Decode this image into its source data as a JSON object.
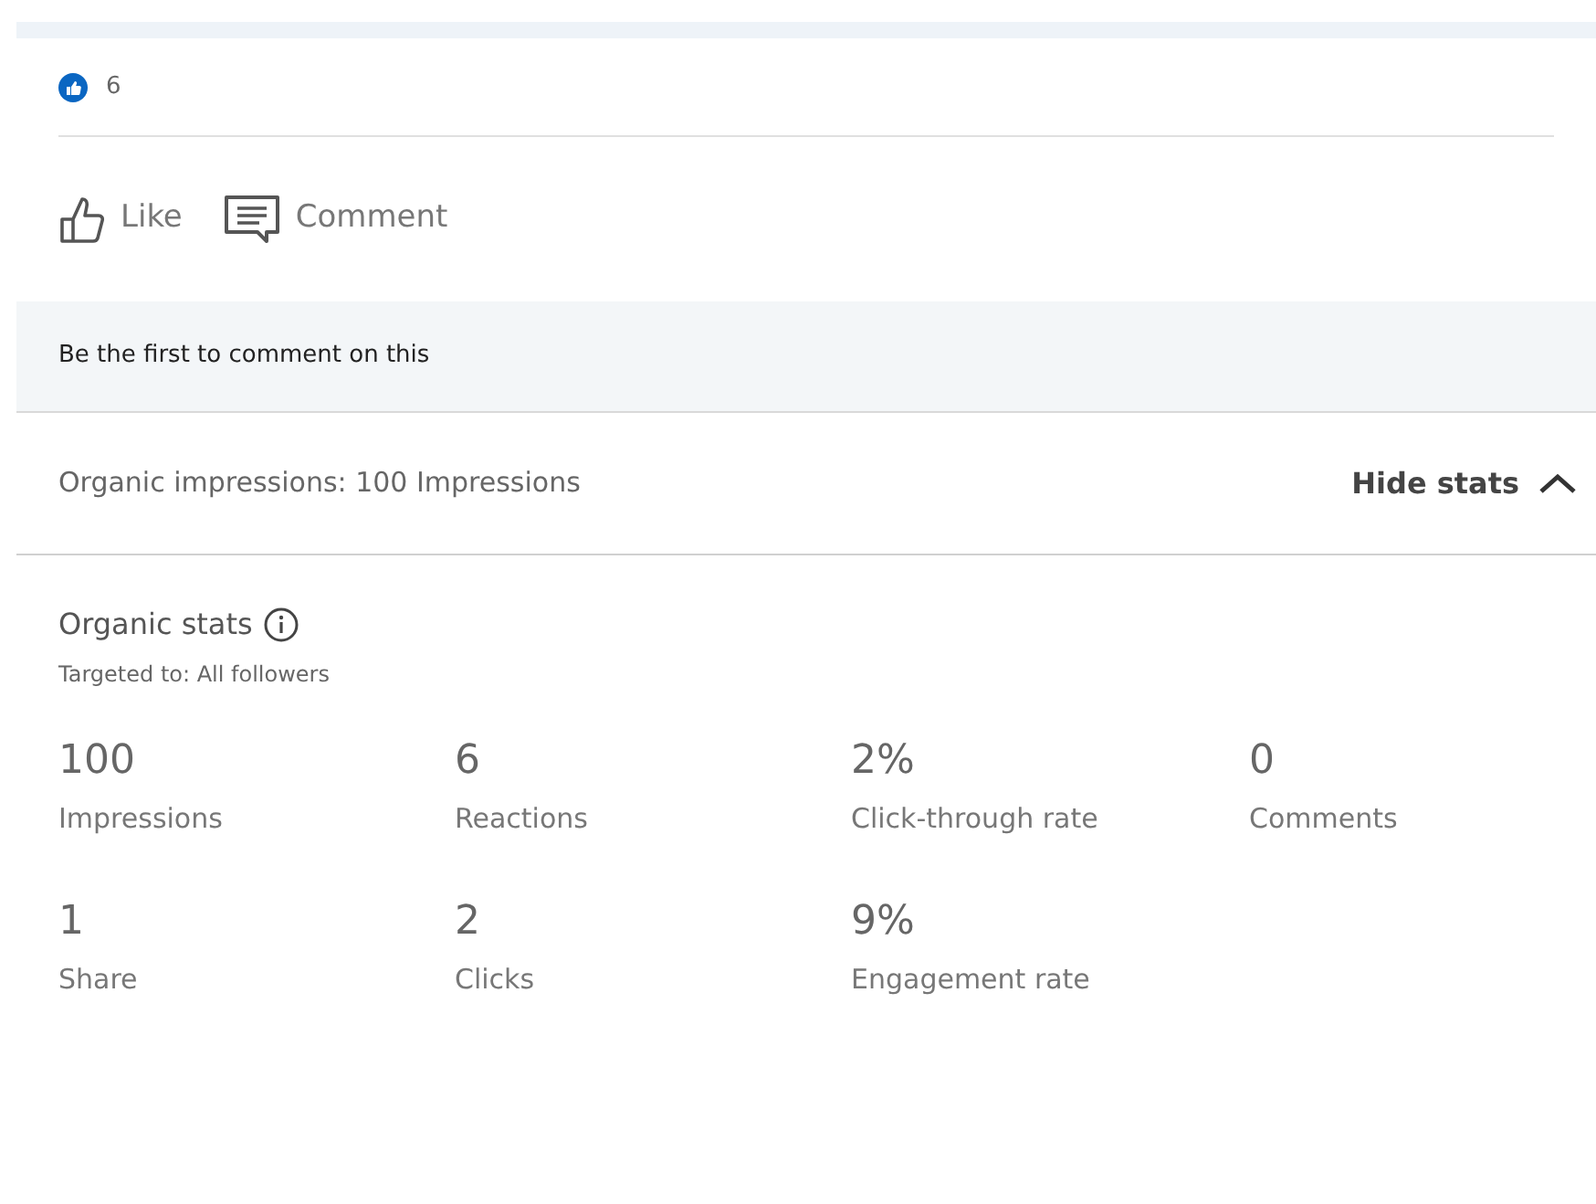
{
  "reactions": {
    "count": "6"
  },
  "actions": [
    {
      "kind": "like",
      "label": "Like"
    },
    {
      "kind": "comment",
      "label": "Comment"
    }
  ],
  "comments_banner": "Be the first to comment on this",
  "impressions_bar": {
    "summary": "Organic impressions: 100 Impressions",
    "toggle": "Hide stats",
    "expanded": true
  },
  "stats": {
    "title": "Organic stats",
    "targeting": "Targeted to: All followers",
    "items": [
      {
        "value": "100",
        "label": "Impressions"
      },
      {
        "value": "6",
        "label": "Reactions"
      },
      {
        "value": "2%",
        "label": "Click-through rate"
      },
      {
        "value": "0",
        "label": "Comments"
      },
      {
        "value": "1",
        "label": "Share"
      },
      {
        "value": "2",
        "label": "Clicks"
      },
      {
        "value": "9%",
        "label": "Engagement rate"
      }
    ]
  }
}
